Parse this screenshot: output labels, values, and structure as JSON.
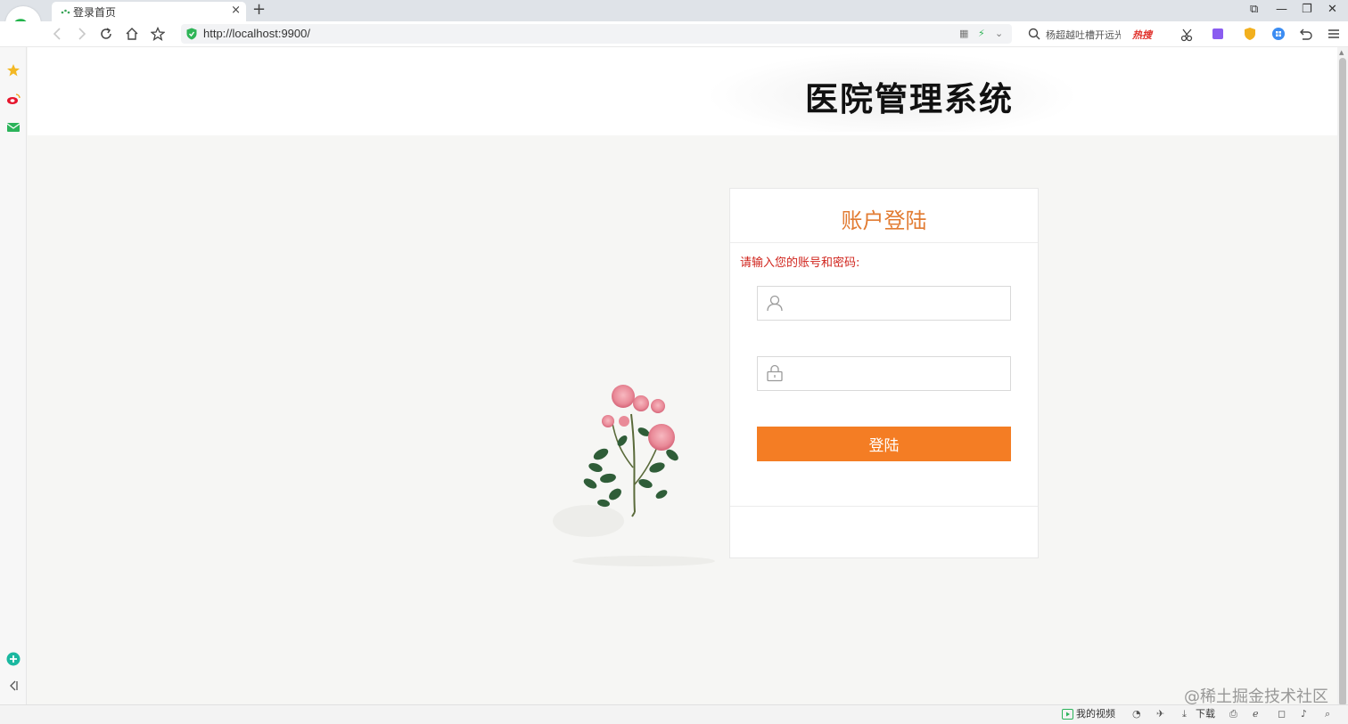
{
  "browser": {
    "tab_title": "登录首页",
    "tab_close": "×",
    "new_tab": "+",
    "url": "http://localhost:9900/",
    "search_text": "杨超越吐槽开远光",
    "hot_label": "热搜",
    "window_controls": [
      "⧉",
      "—",
      "❐",
      "✕"
    ]
  },
  "statusbar": {
    "my_video": "我的视频",
    "download": "下载"
  },
  "watermark": "@稀土掘金技术社区",
  "page": {
    "site_title": "医院管理系统",
    "login": {
      "title": "账户登陆",
      "hint": "请输入您的账号和密码:",
      "username_value": "",
      "password_value": "",
      "submit_label": "登陆"
    }
  },
  "colors": {
    "accent": "#f47d24",
    "title_orange": "#e27c33",
    "hint_red": "#d0241c"
  }
}
